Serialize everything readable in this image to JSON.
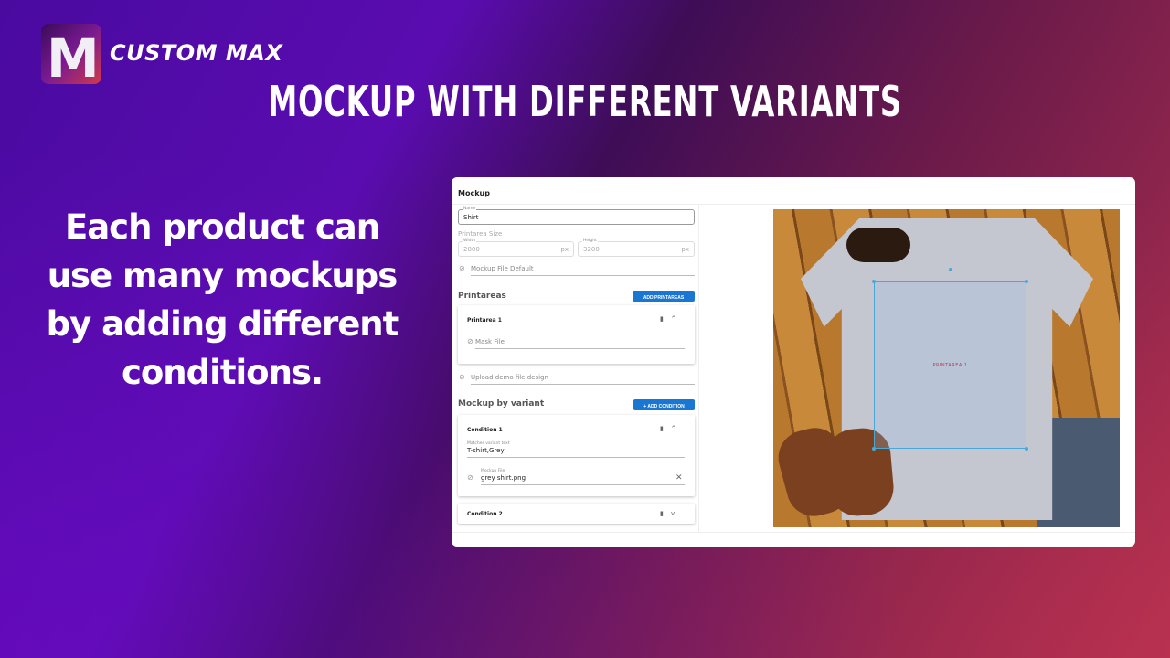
{
  "brand": {
    "logo_letter": "M",
    "name": "CUSTOM MAX"
  },
  "headline": "MOCKUP WITH DIFFERENT VARIANTS",
  "description": "Each product can use many mockups by adding different conditions.",
  "panel": {
    "title": "Mockup",
    "name": {
      "label": "Name",
      "value": "Shirt"
    },
    "printarea_size": {
      "label": "Printarea Size",
      "width_label": "Width",
      "width": "2800",
      "height_label": "Height",
      "height": "3200",
      "unit": "px"
    },
    "mockup_file_default": "Mockup File Default",
    "printareas": {
      "title": "Printareas",
      "add_label": "ADD PRINTAREAS",
      "items": [
        {
          "title": "Printarea 1",
          "mask_file": "Mask File"
        }
      ]
    },
    "upload_demo": "Upload demo file design",
    "mockup_by_variant": {
      "title": "Mockup by variant",
      "add_label": "ADD CONDITION",
      "conditions": [
        {
          "title": "Condition 1",
          "match_label": "Matches variant text",
          "match_value": "T-shirt,Grey",
          "file_label": "Mockup File",
          "file_value": "grey shirt.png",
          "expanded": true
        },
        {
          "title": "Condition 2",
          "expanded": false
        }
      ]
    },
    "preview": {
      "printarea_label": "PRINTAREA 1"
    }
  },
  "colors": {
    "accent": "#1976d2"
  }
}
